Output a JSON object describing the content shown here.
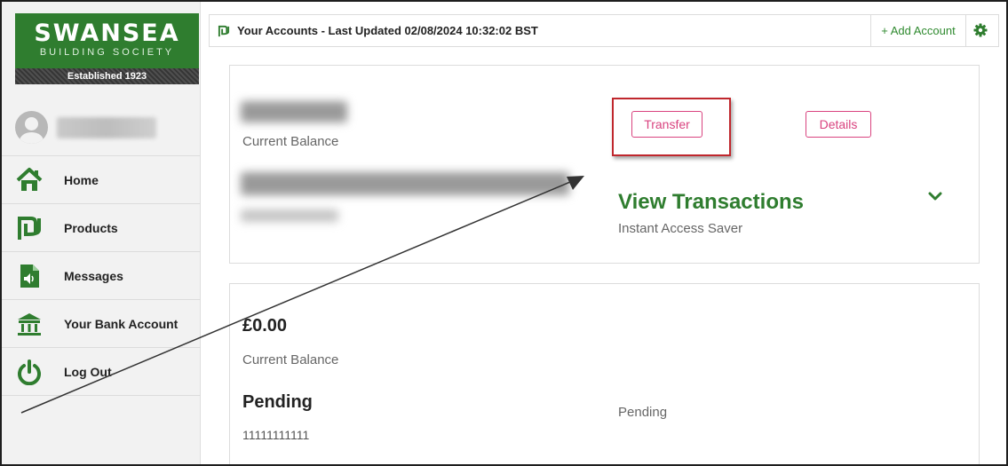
{
  "brand": {
    "name": "SWANSEA",
    "subtitle": "BUILDING SOCIETY",
    "established": "Established 1923",
    "color": "#2f7d2f"
  },
  "sidebar": {
    "items": [
      {
        "label": "Home",
        "icon": "home-icon"
      },
      {
        "label": "Products",
        "icon": "products-icon"
      },
      {
        "label": "Messages",
        "icon": "messages-icon"
      },
      {
        "label": "Your Bank Account",
        "icon": "bank-icon"
      },
      {
        "label": "Log Out",
        "icon": "power-icon"
      }
    ]
  },
  "header": {
    "title": "Your Accounts - Last Updated 02/08/2024 10:32:02 BST",
    "add_account": "+ Add Account",
    "settings_icon": "gear-icon"
  },
  "accounts": [
    {
      "balance_label": "Current Balance",
      "transfer_label": "Transfer",
      "details_label": "Details",
      "view_transactions": "View Transactions",
      "account_type": "Instant Access Saver"
    },
    {
      "balance": "£0.00",
      "balance_label": "Current Balance",
      "name": "Pending",
      "account_number": "11111111111",
      "status": "Pending"
    }
  ],
  "colors": {
    "accent_pink": "#d9437f",
    "highlight_red": "#c0272d",
    "green": "#2f7d2f"
  }
}
